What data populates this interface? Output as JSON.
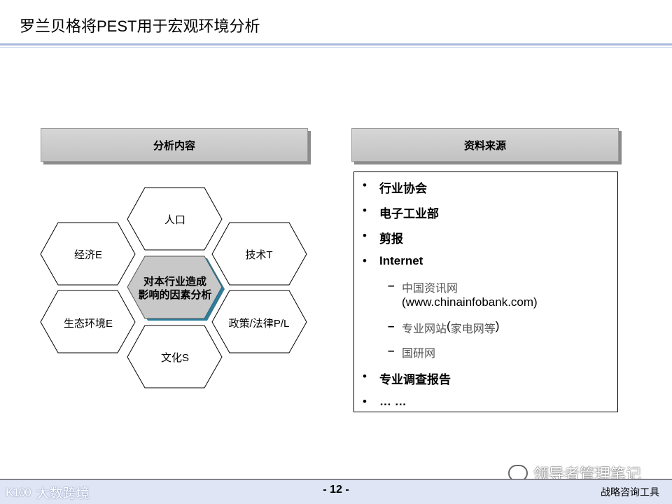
{
  "slide": {
    "title": "罗兰贝格将PEST用于宏观环境分析",
    "page_number": "- 12 -",
    "footer_right": "战略咨询工具",
    "logo_left_text": "大数跨境",
    "logo_left_mark": "K100",
    "watermark_text": "领导者管理笔记"
  },
  "analysis": {
    "header": "分析内容",
    "center_line1": "对本行业造成",
    "center_line2": "影响的因素分析",
    "factors": {
      "top": "人口",
      "upper_left": "经济E",
      "upper_right": "技术T",
      "lower_left": "生态环境E",
      "lower_right": "政策/法律P/L",
      "bottom": "文化S"
    }
  },
  "sources": {
    "header": "资料来源",
    "items": {
      "i1": "行业协会",
      "i2": "电子工业部",
      "i3": "剪报",
      "i4": "Internet",
      "s1_cn": "中国资讯网",
      "s1_url": "(www.chinainfobank.com)",
      "s2_cn": "专业网站",
      "s2_paren_open": "(",
      "s2_cn_inner": "家电网等",
      "s2_paren_close": ")",
      "s3_cn": "国研网",
      "i5": "专业调查报告",
      "i6": "… …"
    },
    "bullet_char": "•",
    "dash_char": "–"
  },
  "colors": {
    "center_fill": "#c8c8c8",
    "center_shadow": "#2a7fa0",
    "title_rule": "#a9b8dd",
    "footer_band": "#dfe5f4"
  }
}
